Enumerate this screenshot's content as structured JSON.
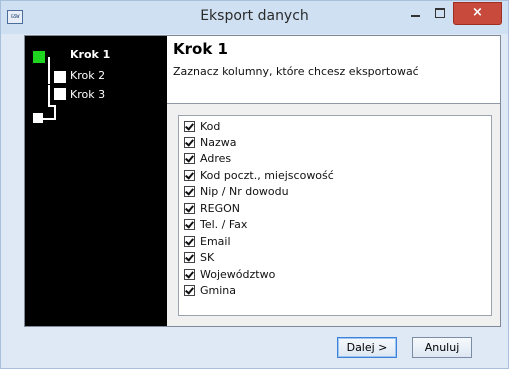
{
  "window": {
    "icon_text": "GSW",
    "title": "Eksport danych",
    "close_glyph": "×"
  },
  "sidebar": {
    "steps": [
      {
        "label": "Krok 1",
        "active": true
      },
      {
        "label": "Krok 2",
        "active": false
      },
      {
        "label": "Krok 3",
        "active": false
      }
    ]
  },
  "header": {
    "title": "Krok 1",
    "description": "Zaznacz kolumny, które chcesz eksportować"
  },
  "columns": [
    {
      "label": "Kod",
      "checked": true
    },
    {
      "label": "Nazwa",
      "checked": true
    },
    {
      "label": "Adres",
      "checked": true
    },
    {
      "label": "Kod poczt., miejscowość",
      "checked": true
    },
    {
      "label": "Nip / Nr dowodu",
      "checked": true
    },
    {
      "label": "REGON",
      "checked": true
    },
    {
      "label": "Tel. / Fax",
      "checked": true
    },
    {
      "label": "Email",
      "checked": true
    },
    {
      "label": "SK",
      "checked": true
    },
    {
      "label": "Województwo",
      "checked": true
    },
    {
      "label": "Gmina",
      "checked": true
    }
  ],
  "buttons": {
    "next": "Dalej >",
    "cancel": "Anuluj"
  },
  "colors": {
    "active_step": "#1ed620",
    "close_button": "#c74a3c"
  }
}
